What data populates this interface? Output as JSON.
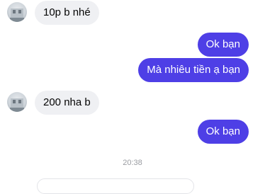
{
  "messages": [
    {
      "from": "other",
      "text": "10p b nhé"
    },
    {
      "from": "me",
      "text": "Ok bạn"
    },
    {
      "from": "me",
      "text": "Mà nhiêu tiền ạ bạn"
    },
    {
      "from": "other",
      "text": "200 nha b"
    },
    {
      "from": "me",
      "text": "Ok bạn"
    }
  ],
  "timestamp": "20:38",
  "colors": {
    "incoming_bubble": "#eff0f3",
    "outgoing_bubble": "#4e3fe6",
    "timestamp": "#9a9ca1"
  }
}
